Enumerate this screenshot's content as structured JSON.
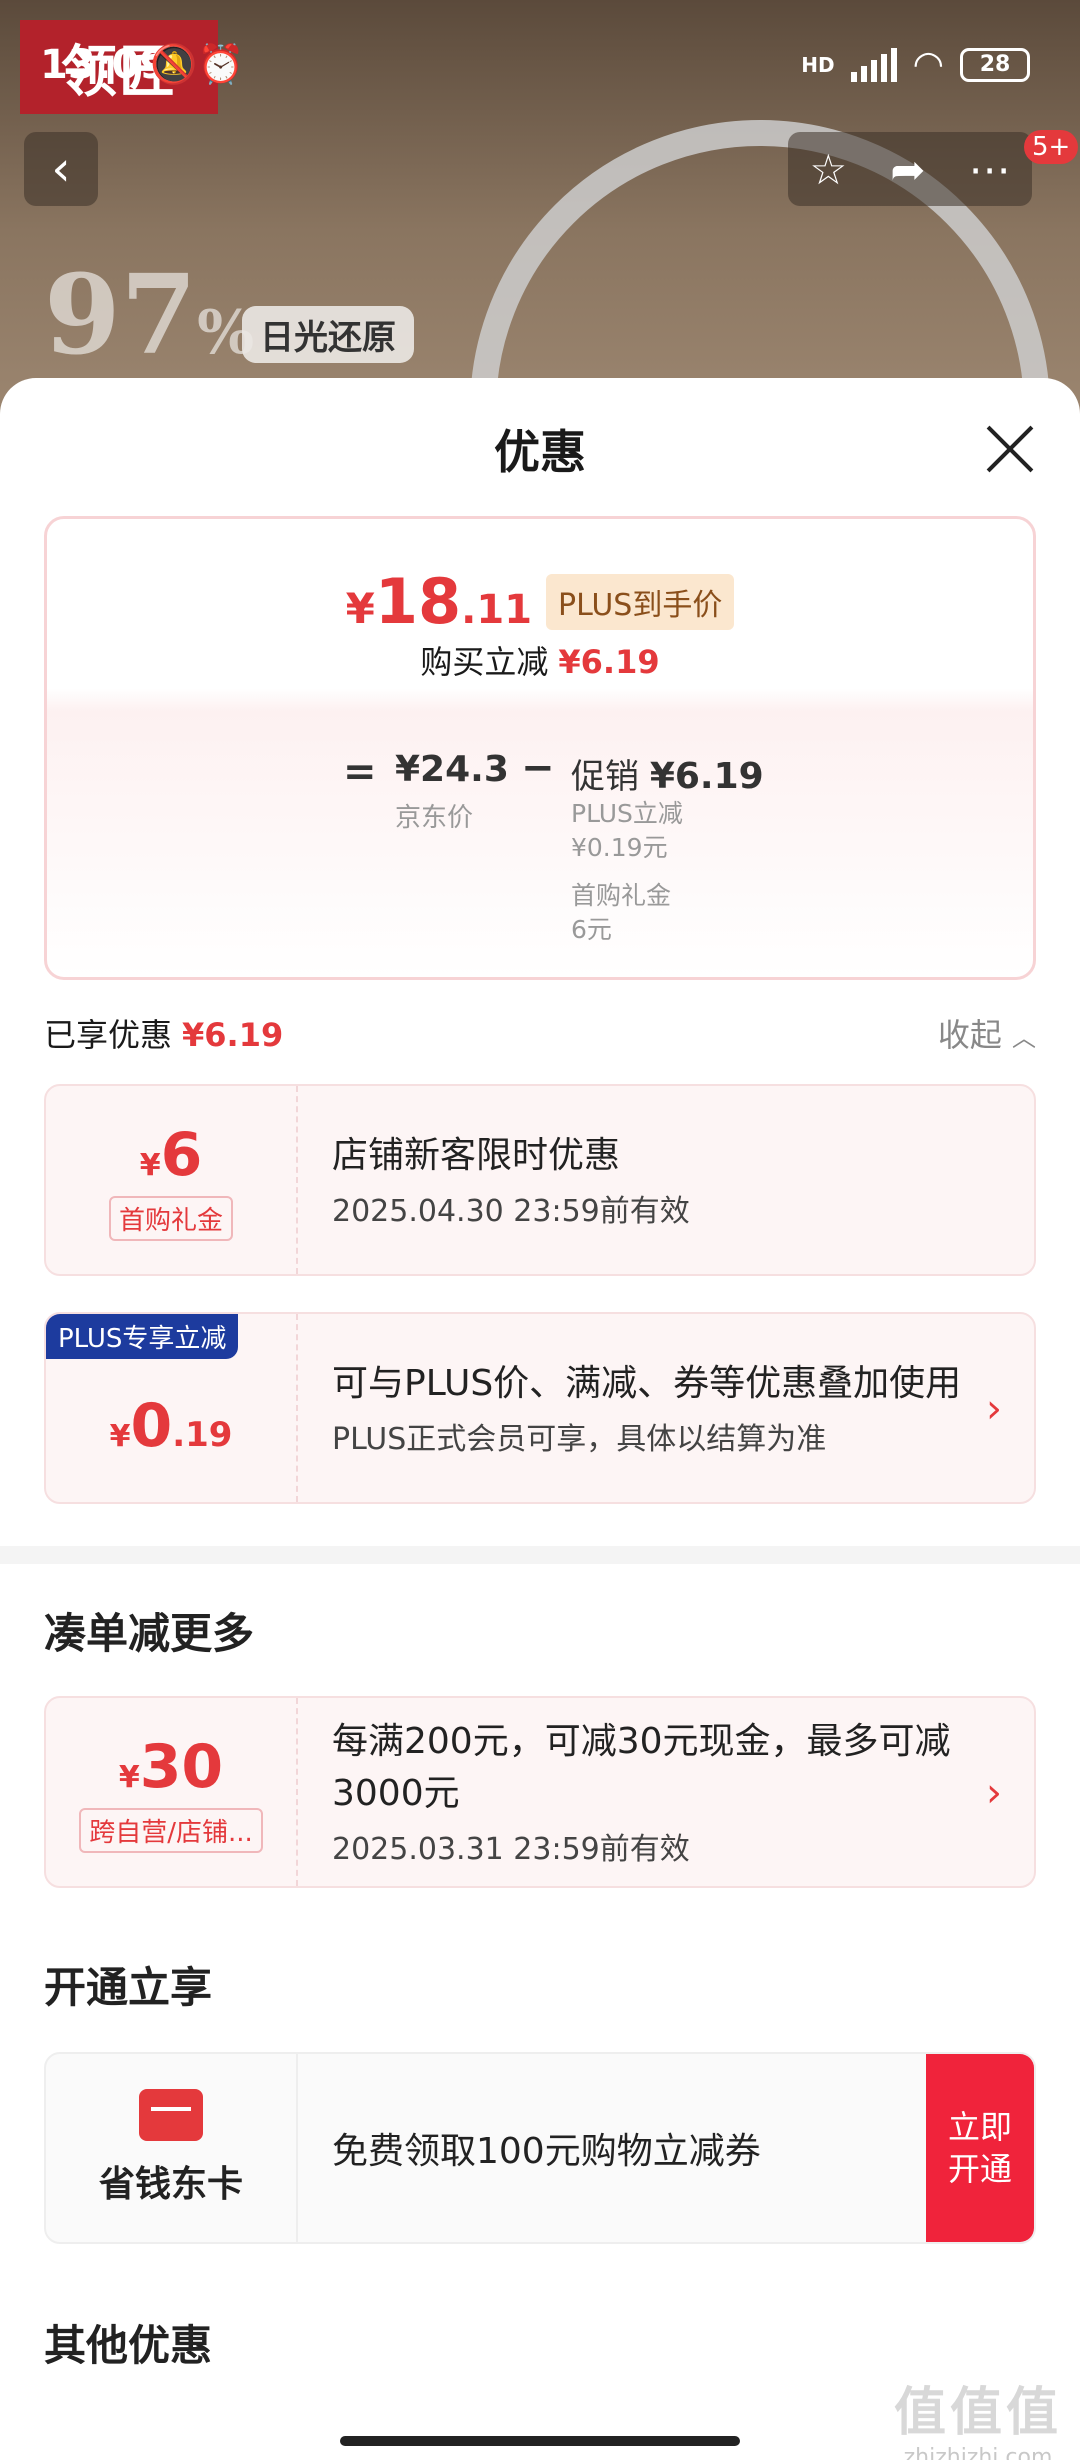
{
  "status_bar": {
    "time": "13:09",
    "network": "HD",
    "battery": "28"
  },
  "background": {
    "logo": "领匠",
    "percent": "97",
    "percent_unit": "%",
    "feature_tag": "日光还原",
    "message_badge": "5+"
  },
  "sheet": {
    "title": "优惠"
  },
  "price_card": {
    "currency": "¥",
    "final_int": "18",
    "final_dec": ".11",
    "plus_tag": "PLUS到手价",
    "buy_label": "购买立减",
    "buy_amount": "¥6.19",
    "equals": "=",
    "jd_price": "¥24.3",
    "jd_label": "京东价",
    "minus": "−",
    "promo_label": "促销",
    "promo_amount": "¥6.19",
    "sub1_label": "PLUS立减",
    "sub1_value": "¥0.19元",
    "sub2_label": "首购礼金",
    "sub2_value": "6元"
  },
  "enjoyed": {
    "label": "已享优惠",
    "amount": "¥6.19",
    "collapse": "收起"
  },
  "coupons": [
    {
      "currency": "¥",
      "amount": "6",
      "tag": "首购礼金",
      "title": "店铺新客限时优惠",
      "sub": "2025.04.30 23:59前有效"
    },
    {
      "corner": "PLUS专享立减",
      "currency": "¥",
      "amount": "0",
      "decimal": ".19",
      "title": "可与PLUS价、满减、券等优惠叠加使用",
      "sub": "PLUS正式会员可享，具体以结算为准"
    }
  ],
  "more_section": {
    "title": "凑单减更多",
    "coupon": {
      "currency": "¥",
      "amount": "30",
      "tag": "跨自营/店铺...",
      "title": "每满200元，可减30元现金，最多可减3000元",
      "sub": "2025.03.31 23:59前有效"
    }
  },
  "open_section": {
    "title": "开通立享",
    "card_name": "省钱东卡",
    "text": "免费领取100元购物立减券",
    "button": "立即开通"
  },
  "other_section": {
    "title": "其他优惠"
  },
  "watermark": {
    "big": "值值值",
    "small": "zhizhizhi.com"
  },
  "colors": {
    "accent": "#e4393c",
    "plus_blue": "#1d3b9e",
    "plus_gold_bg": "#fbe7cf"
  }
}
